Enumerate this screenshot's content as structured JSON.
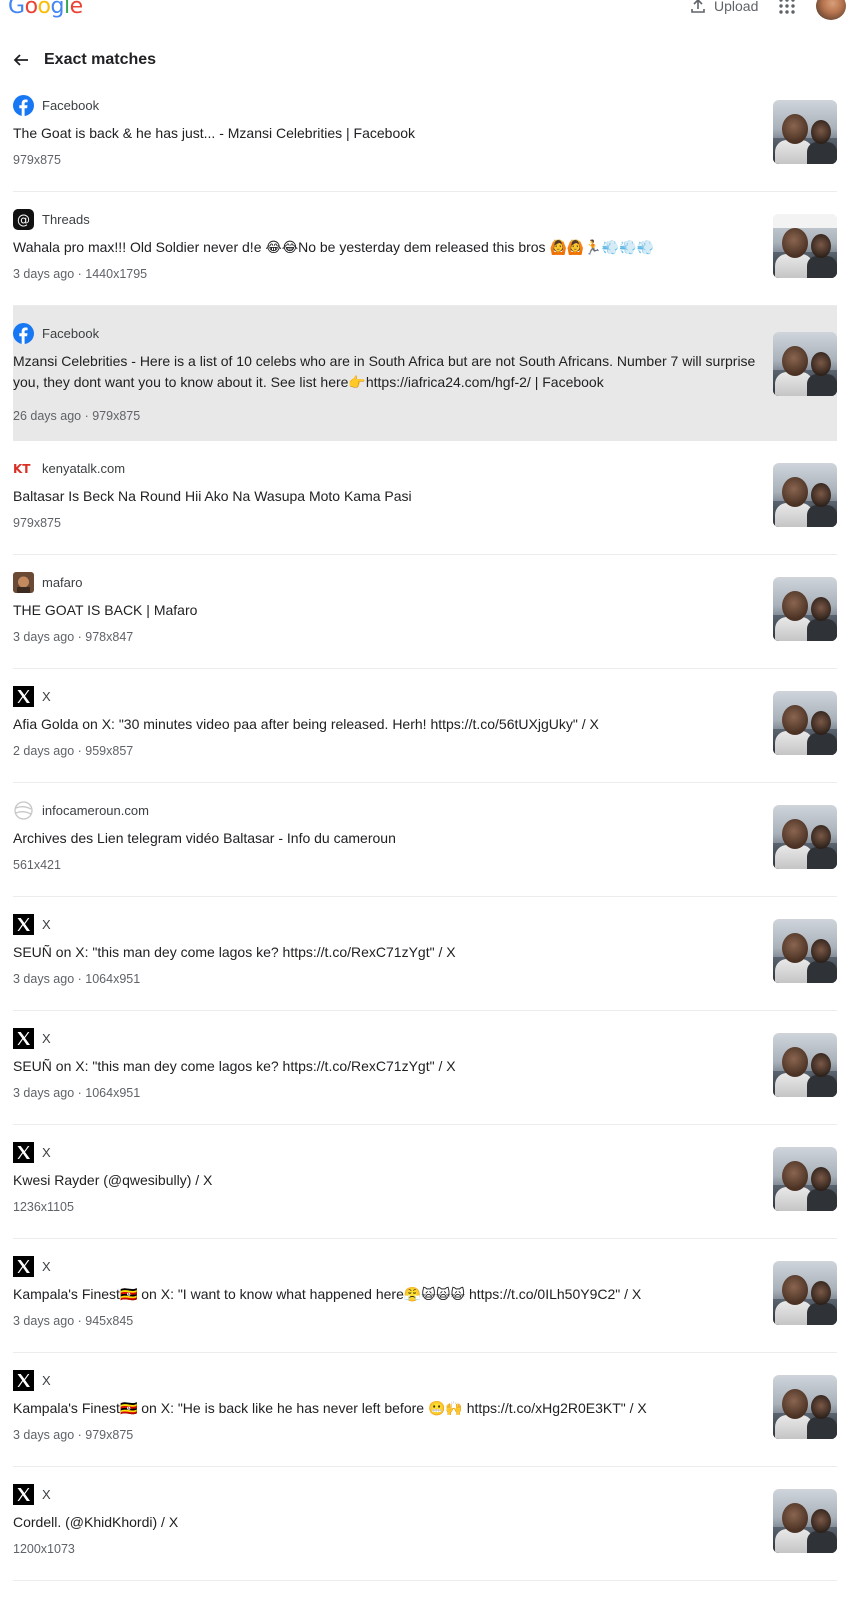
{
  "app": {
    "logo": "Google",
    "upload_label": "Upload",
    "page_title": "Exact matches",
    "logo_colors": [
      "#4285F4",
      "#EA4335",
      "#FBBC05",
      "#4285F4",
      "#34A853",
      "#EA4335"
    ]
  },
  "results": [
    {
      "source": "Facebook",
      "icon": "facebook-icon",
      "title": "The Goat is back & he has just... - Mzansi Celebrities | Facebook",
      "meta": "979x875"
    },
    {
      "source": "Threads",
      "icon": "threads-icon",
      "title": "Wahala pro max!!! Old Soldier never d!e 😂😂No be yesterday dem released this bros 🙆🙆🏃💨💨💨",
      "meta": "3 days ago · 1440x1795",
      "thumb_strip": true
    },
    {
      "source": "Facebook",
      "icon": "facebook-icon",
      "title": "Mzansi Celebrities - Here is a list of 10 celebs who are in South Africa but are not South Africans. Number 7 will surprise you, they dont want you to know about it. See list here👉https://iafrica24.com/hgf-2/ | Facebook",
      "meta": "26 days ago · 979x875",
      "highlight": true
    },
    {
      "source": "kenyatalk.com",
      "icon": "kenyatalk-icon",
      "title": "Baltasar Is Beck Na Round Hii Ako Na Wasupa Moto Kama Pasi",
      "meta": "979x875"
    },
    {
      "source": "mafaro",
      "icon": "mafaro-icon",
      "title": "THE GOAT IS BACK | Mafaro",
      "meta": "3 days ago · 978x847"
    },
    {
      "source": "X",
      "icon": "x-icon",
      "title": "Afia Golda on X: \"30 minutes video paa after being released. Herh! https://t.co/56tUXjgUky\" / X",
      "meta": "2 days ago · 959x857"
    },
    {
      "source": "infocameroun.com",
      "icon": "globe-icon",
      "title": "Archives des Lien telegram vidéo Baltasar - Info du cameroun",
      "meta": "561x421"
    },
    {
      "source": "X",
      "icon": "x-icon",
      "title": "SEUÑ on X: \"this man dey come lagos ke? https://t.co/RexC71zYgt\" / X",
      "meta": "3 days ago · 1064x951"
    },
    {
      "source": "X",
      "icon": "x-icon",
      "title": "SEUÑ on X: \"this man dey come lagos ke? https://t.co/RexC71zYgt\" / X",
      "meta": "3 days ago · 1064x951"
    },
    {
      "source": "X",
      "icon": "x-icon",
      "title": "Kwesi Rayder (@qwesibully) / X",
      "meta": "1236x1105"
    },
    {
      "source": "X",
      "icon": "x-icon",
      "title": "Kampala's Finest🇺🇬 on X: \"I want to know what happened here😤🙀🙀🙀 https://t.co/0ILh50Y9C2\" / X",
      "meta": "3 days ago · 945x845"
    },
    {
      "source": "X",
      "icon": "x-icon",
      "title": "Kampala's Finest🇺🇬 on X: \"He is back like he has never left before 😬🙌 https://t.co/xHg2R0E3KT\" / X",
      "meta": "3 days ago · 979x875"
    },
    {
      "source": "X",
      "icon": "x-icon",
      "title": "Cordell. (@KhidKhordi) / X",
      "meta": "1200x1073"
    }
  ]
}
